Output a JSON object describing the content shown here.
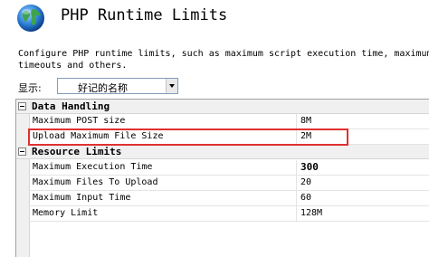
{
  "header": {
    "title": "PHP Runtime Limits",
    "icon": "globe-icon"
  },
  "description": "Configure PHP runtime limits, such as maximum script execution time, maximum\ntimeouts and others.",
  "view": {
    "label": "显示:",
    "selected": "好记的名称"
  },
  "grid": {
    "categories": [
      {
        "label": "Data Handling",
        "rows": [
          {
            "name": "Maximum POST size",
            "value": "8M"
          },
          {
            "name": "Upload Maximum File Size",
            "value": "2M"
          }
        ]
      },
      {
        "label": "Resource Limits",
        "rows": [
          {
            "name": "Maximum Execution Time",
            "value": "300"
          },
          {
            "name": "Maximum Files To Upload",
            "value": "20"
          },
          {
            "name": "Maximum Input Time",
            "value": "60"
          },
          {
            "name": "Memory Limit",
            "value": "128M"
          }
        ]
      }
    ]
  },
  "colors": {
    "highlight": "#e03030",
    "category_bg": "#f0f0f0"
  }
}
